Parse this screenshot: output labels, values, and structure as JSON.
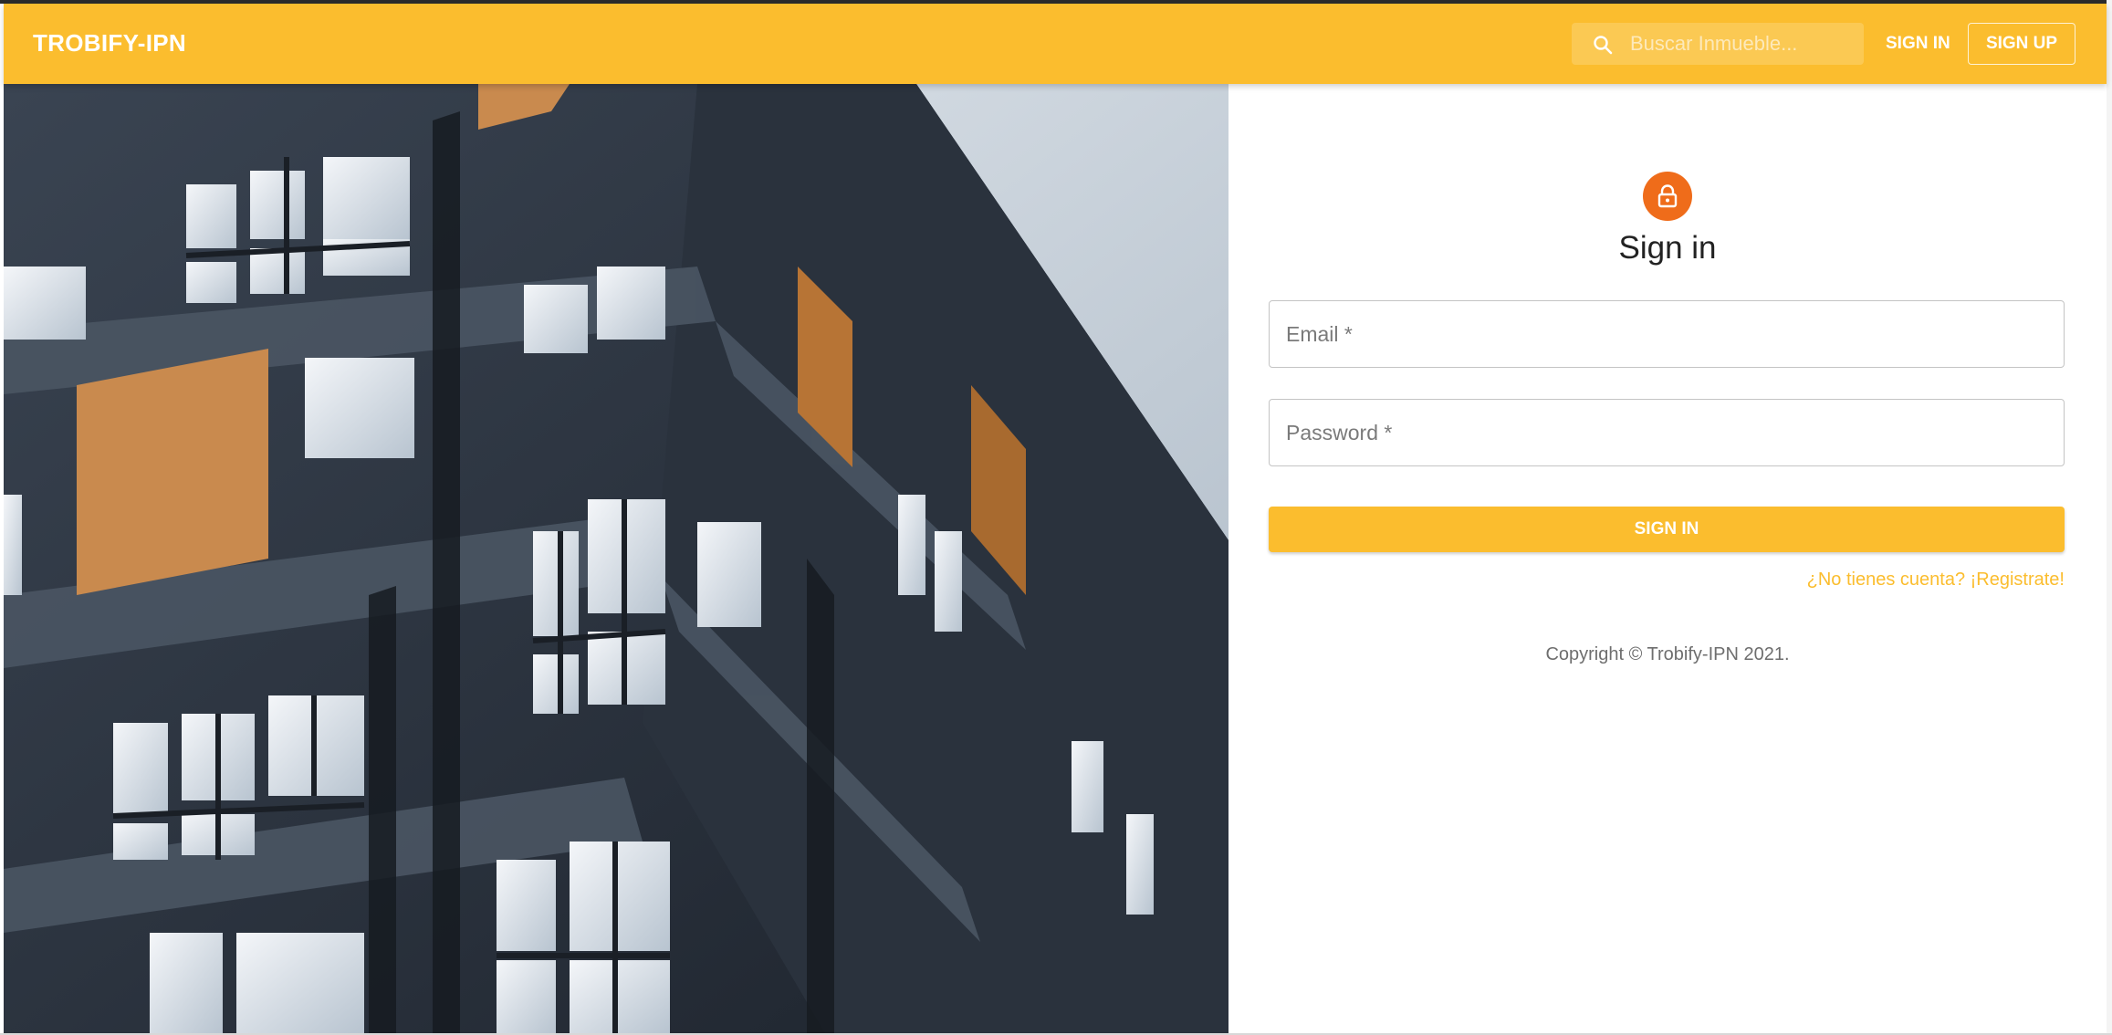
{
  "header": {
    "brand": "TROBIFY-IPN",
    "search_placeholder": "Buscar Inmueble...",
    "signin_label": "SIGN IN",
    "signup_label": "SIGN UP"
  },
  "form": {
    "title": "Sign in",
    "email_placeholder": "Email *",
    "password_placeholder": "Password *",
    "submit_label": "SIGN IN",
    "register_link": "¿No tienes cuenta? ¡Registrate!"
  },
  "footer": {
    "copyright": "Copyright © Trobify-IPN 2021."
  },
  "colors": {
    "primary": "#fbbd2e",
    "avatar": "#ef6c1a"
  }
}
